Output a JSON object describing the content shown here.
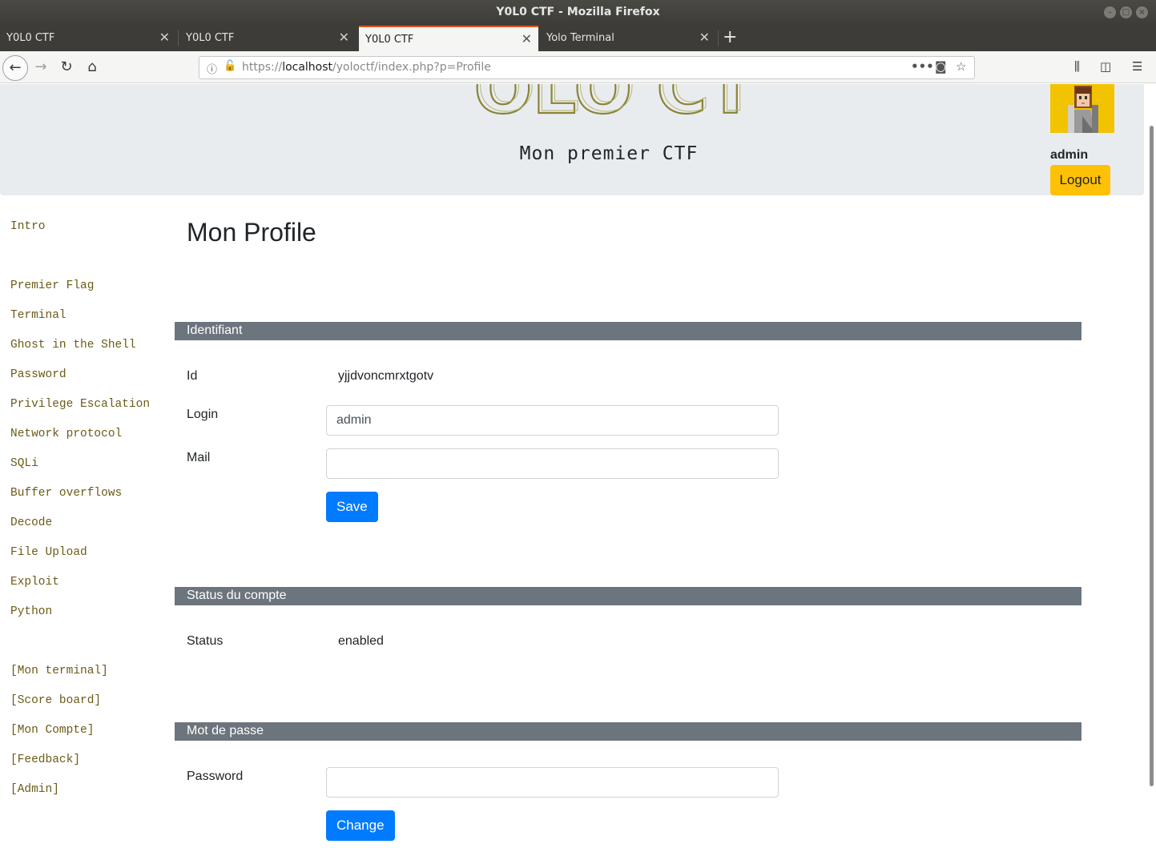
{
  "window": {
    "title": "Y0L0 CTF - Mozilla Firefox"
  },
  "tabs": [
    {
      "label": "Y0L0 CTF",
      "active": false
    },
    {
      "label": "Y0L0 CTF",
      "active": false
    },
    {
      "label": "Y0L0 CTF",
      "active": true
    },
    {
      "label": "Yolo Terminal",
      "active": false
    }
  ],
  "url": {
    "prefix": "https://",
    "host": "localhost",
    "path": "/yoloctf/index.php?p=Profile"
  },
  "header": {
    "logo_text": "YOLO CTF",
    "subtitle": "Mon premier CTF",
    "username": "admin",
    "logout_label": "Logout"
  },
  "sidebar": {
    "intro": "Intro",
    "challenges": [
      "Premier Flag",
      "Terminal",
      "Ghost in the Shell",
      "Password",
      "Privilege Escalation",
      "Network protocol",
      "SQLi",
      "Buffer overflows",
      "Decode",
      "File Upload",
      "Exploit",
      "Python"
    ],
    "extras": [
      "[Mon terminal]",
      "[Score board]",
      "[Mon Compte]",
      "[Feedback]",
      "[Admin]"
    ]
  },
  "main": {
    "title": "Mon Profile",
    "identifiant": {
      "header": "Identifiant",
      "id_label": "Id",
      "id_value": "yjjdvoncmrxtgotv",
      "login_label": "Login",
      "login_value": "admin",
      "mail_label": "Mail",
      "mail_value": "",
      "save_label": "Save"
    },
    "status": {
      "header": "Status du compte",
      "label": "Status",
      "value": "enabled"
    },
    "password": {
      "header": "Mot de passe",
      "label": "Password",
      "value": "",
      "change_label": "Change"
    }
  },
  "colors": {
    "section_bar": "#6c757d",
    "primary": "#007bff",
    "warning": "#ffc107",
    "link": "#6b5b18",
    "header_bg": "#e9ecef"
  },
  "icons": [
    "back-icon",
    "forward-icon",
    "reload-icon",
    "home-icon",
    "info-icon",
    "insecure-lock-icon",
    "more-icon",
    "pocket-icon",
    "bookmark-star-icon",
    "library-icon",
    "sidebar-icon",
    "menu-icon"
  ]
}
